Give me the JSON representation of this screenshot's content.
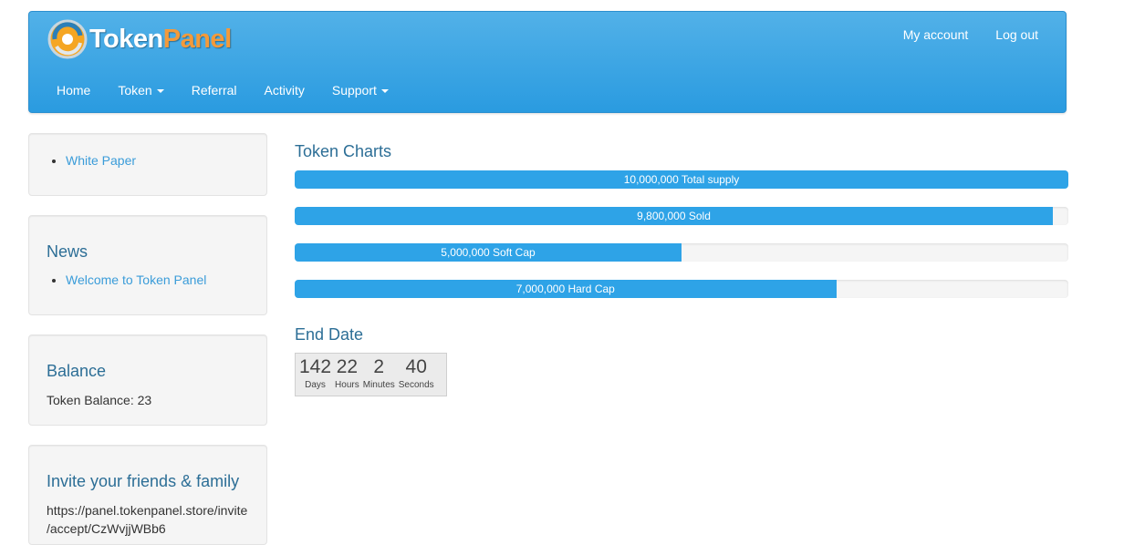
{
  "header": {
    "logo": {
      "part1": "Token",
      "part2": "Panel"
    },
    "top_links": [
      "My account",
      "Log out"
    ],
    "nav": [
      {
        "label": "Home",
        "dropdown": false
      },
      {
        "label": "Token",
        "dropdown": true
      },
      {
        "label": "Referral",
        "dropdown": false
      },
      {
        "label": "Activity",
        "dropdown": false
      },
      {
        "label": "Support",
        "dropdown": true
      }
    ]
  },
  "sidebar": {
    "links_box": {
      "items": [
        "White Paper"
      ]
    },
    "news": {
      "title": "News",
      "items": [
        "Welcome to Token Panel"
      ]
    },
    "balance": {
      "title": "Balance",
      "text": "Token Balance: 23"
    },
    "invite": {
      "title": "Invite your friends & family",
      "url_line1": "https://panel.tokenpanel.store/invite",
      "url_line2": "/accept/CzWvjjWBb6"
    }
  },
  "main": {
    "charts_title": "Token Charts",
    "bars": [
      {
        "label": "10,000,000 Total supply",
        "percent": 100
      },
      {
        "label": "9,800,000 Sold",
        "percent": 98
      },
      {
        "label": "5,000,000 Soft Cap",
        "percent": 50
      },
      {
        "label": "7,000,000 Hard Cap",
        "percent": 70
      }
    ],
    "end_date_title": "End Date",
    "countdown": [
      {
        "value": "142",
        "label": "Days"
      },
      {
        "value": "22",
        "label": "Hours"
      },
      {
        "value": "2",
        "label": "Minutes"
      },
      {
        "value": "40",
        "label": "Seconds"
      }
    ]
  },
  "colors": {
    "brand_blue": "#2ea3e7",
    "logo_orange": "#f39a3b",
    "heading": "#2c6e96",
    "link": "#3a9cd9"
  }
}
